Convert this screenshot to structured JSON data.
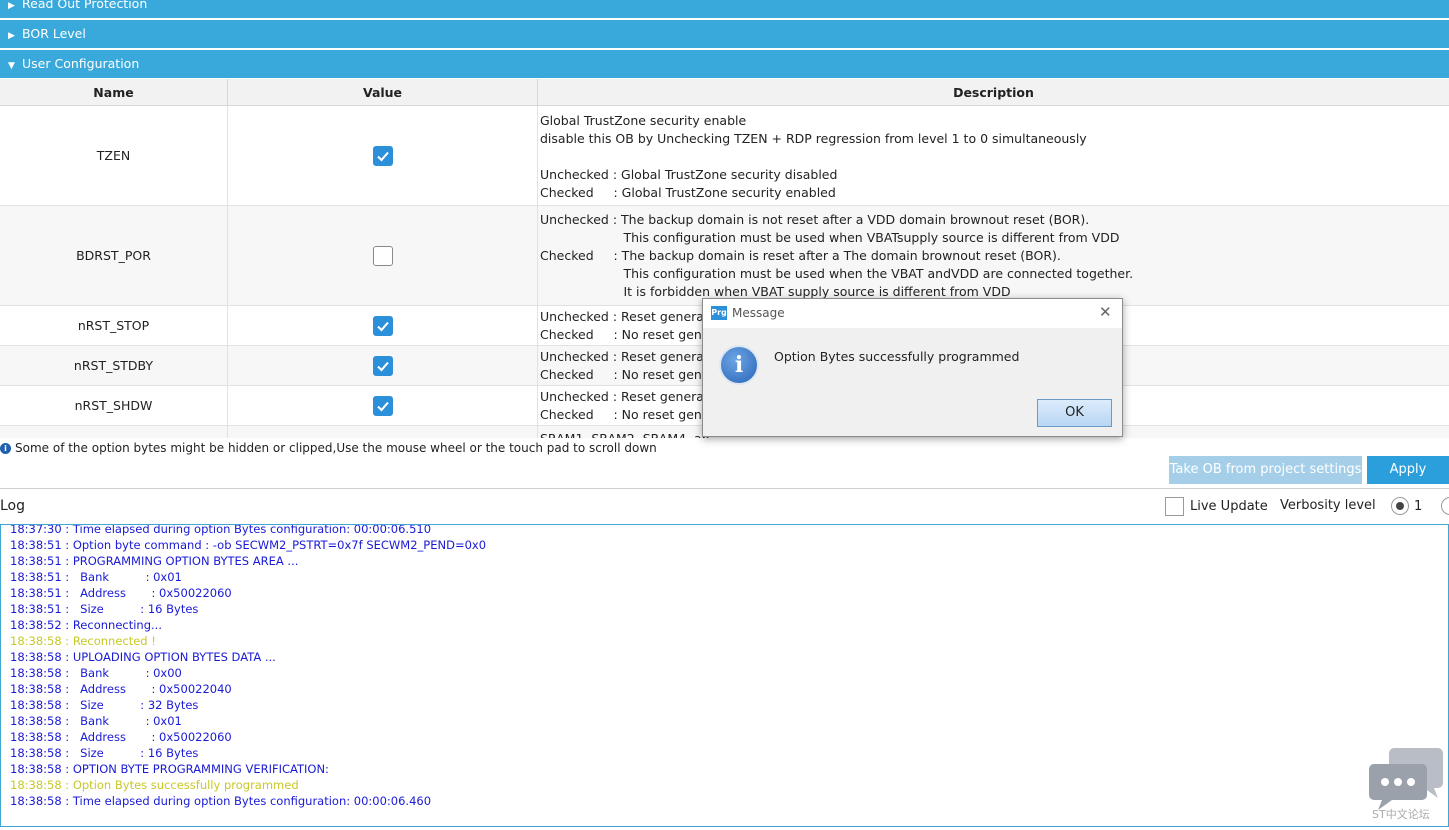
{
  "sections": [
    {
      "label": "Read Out Protection",
      "expanded": false
    },
    {
      "label": "BOR Level",
      "expanded": false
    },
    {
      "label": "User Configuration",
      "expanded": true
    }
  ],
  "table": {
    "headers": [
      "Name",
      "Value",
      "Description"
    ],
    "rows": [
      {
        "name": "TZEN",
        "checked": true,
        "description": "Global TrustZone security enable\ndisable this OB by Unchecking TZEN + RDP regression from level 1 to 0 simultaneously\n\nUnchecked : Global TrustZone security disabled\nChecked     : Global TrustZone security enabled"
      },
      {
        "name": "BDRST_POR",
        "checked": false,
        "description": "Unchecked : The backup domain is not reset after a VDD domain brownout reset (BOR).\n                     This configuration must be used when VBATsupply source is different from VDD\nChecked     : The backup domain is reset after a The domain brownout reset (BOR).\n                     This configuration must be used when the VBAT andVDD are connected together.\n                     It is forbidden when VBAT supply source is different from VDD"
      },
      {
        "name": "nRST_STOP",
        "checked": true,
        "description": "Unchecked : Reset generate\nChecked     : No reset gener"
      },
      {
        "name": "nRST_STDBY",
        "checked": true,
        "description": "Unchecked : Reset generate\nChecked     : No reset gener"
      },
      {
        "name": "nRST_SHDW",
        "checked": true,
        "description": "Unchecked : Reset generate\nChecked     : No reset gener"
      },
      {
        "name": "",
        "checked": null,
        "description": "SRAM1, SRAM2, SRAM4, an"
      }
    ]
  },
  "info_text": "Some of the option bytes might be hidden or clipped,Use the mouse wheel or the touch pad to scroll down",
  "buttons": {
    "take_ob": "Take OB from project settings",
    "apply": "Apply"
  },
  "log": {
    "title": "Log",
    "live_update_label": "Live Update",
    "verbosity_label": "Verbosity level",
    "verbosity_value": "1",
    "lines": [
      {
        "text": "18:37:30 : Time elapsed during option Bytes configuration: 00:00:06.510",
        "color": "#1a1ad6"
      },
      {
        "text": "18:38:51 : Option byte command : -ob SECWM2_PSTRT=0x7f SECWM2_PEND=0x0",
        "color": "#1a1ad6"
      },
      {
        "text": "18:38:51 : PROGRAMMING OPTION BYTES AREA ...",
        "color": "#1a1ad6"
      },
      {
        "text": "18:38:51 :   Bank          : 0x01",
        "color": "#1a1ad6"
      },
      {
        "text": "18:38:51 :   Address       : 0x50022060",
        "color": "#1a1ad6"
      },
      {
        "text": "18:38:51 :   Size          : 16 Bytes",
        "color": "#1a1ad6"
      },
      {
        "text": "18:38:52 : Reconnecting...",
        "color": "#1a1ad6"
      },
      {
        "text": "18:38:58 : Reconnected !",
        "color": "#c8c828"
      },
      {
        "text": "18:38:58 : UPLOADING OPTION BYTES DATA ...",
        "color": "#1a1ad6"
      },
      {
        "text": "18:38:58 :   Bank          : 0x00",
        "color": "#1a1ad6"
      },
      {
        "text": "18:38:58 :   Address       : 0x50022040",
        "color": "#1a1ad6"
      },
      {
        "text": "18:38:58 :   Size          : 32 Bytes",
        "color": "#1a1ad6"
      },
      {
        "text": "18:38:58 :   Bank          : 0x01",
        "color": "#1a1ad6"
      },
      {
        "text": "18:38:58 :   Address       : 0x50022060",
        "color": "#1a1ad6"
      },
      {
        "text": "18:38:58 :   Size          : 16 Bytes",
        "color": "#1a1ad6"
      },
      {
        "text": "18:38:58 : OPTION BYTE PROGRAMMING VERIFICATION:",
        "color": "#1a1ad6"
      },
      {
        "text": "18:38:58 : Option Bytes successfully programmed",
        "color": "#c8c828"
      },
      {
        "text": "18:38:58 : Time elapsed during option Bytes configuration: 00:00:06.460",
        "color": "#1a1ad6"
      }
    ]
  },
  "dialog": {
    "app_icon": "Prg",
    "title": "Message",
    "message": "Option Bytes successfully programmed",
    "ok_label": "OK",
    "close_glyph": "✕",
    "info_glyph": "i"
  },
  "watermark": "ST中文论坛",
  "colors": {
    "section_bar": "#39a9dc",
    "checkbox_on": "#2b8fd9",
    "log_blue": "#1a1ad6",
    "log_yellow": "#c8c828"
  }
}
